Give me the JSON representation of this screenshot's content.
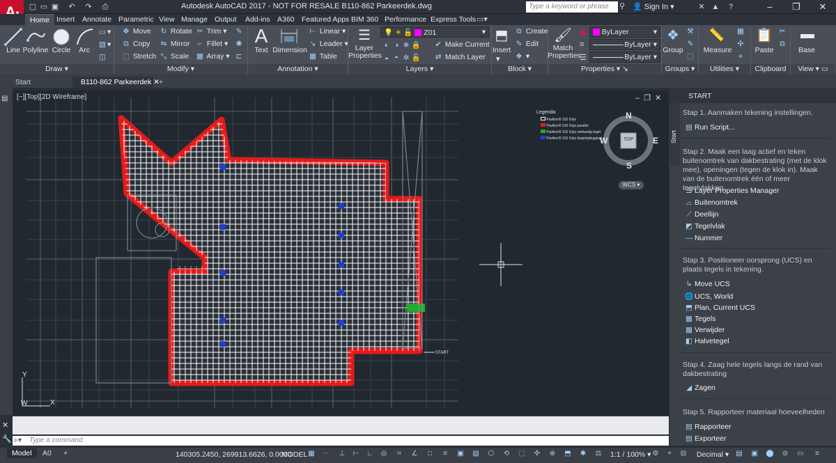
{
  "window": {
    "title": "Autodesk AutoCAD 2017 - NOT FOR RESALE    B110-862 Parkeerdek.dwg",
    "search_placeholder": "Type a keyword or phrase",
    "sign_in": "Sign In"
  },
  "ribbon_tabs": [
    "Home",
    "Insert",
    "Annotate",
    "Parametric",
    "View",
    "Manage",
    "Output",
    "Add-ins",
    "A360",
    "Featured Apps",
    "BIM 360",
    "Performance",
    "Express Tools"
  ],
  "draw": {
    "line": "Line",
    "polyline": "Polyline",
    "circle": "Circle",
    "arc": "Arc",
    "title": "Draw"
  },
  "modify": {
    "move": "Move",
    "rotate": "Rotate",
    "trim": "Trim",
    "copy": "Copy",
    "mirror": "Mirror",
    "fillet": "Fillet",
    "stretch": "Stretch",
    "scale": "Scale",
    "array": "Array",
    "title": "Modify"
  },
  "annotation": {
    "text": "Text",
    "dimension": "Dimension",
    "linear": "Linear",
    "leader": "Leader",
    "table": "Table",
    "title": "Annotation"
  },
  "layers": {
    "layer_properties": "Layer\nProperties",
    "current_layer": "Z01",
    "make_current": "Make Current",
    "match_layer": "Match Layer",
    "title": "Layers"
  },
  "block": {
    "insert": "Insert",
    "create": "Create",
    "edit": "Edit",
    "title": "Block"
  },
  "properties": {
    "match_properties": "Match\nProperties",
    "color": "ByLayer",
    "linetype": "ByLayer",
    "lineweight": "ByLayer",
    "title": "Properties"
  },
  "groups": {
    "group": "Group",
    "title": "Groups"
  },
  "utilities": {
    "measure": "Measure",
    "title": "Utilities"
  },
  "clipboard": {
    "paste": "Paste",
    "title": "Clipboard"
  },
  "view_panel": {
    "base": "Base",
    "title": "View"
  },
  "doc_tabs": [
    "Start",
    "B110-862 Parkeerdek"
  ],
  "viewport": {
    "label": "[−][Top][2D Wireframe]",
    "viewcube": {
      "top": "TOP",
      "n": "N",
      "s": "S",
      "e": "E",
      "w": "W",
      "wcs": "WCS"
    },
    "legend": {
      "title": "Legenda",
      "items": [
        {
          "text": "Pavilion® 310 Grijs",
          "color": "#ffffff"
        },
        {
          "text": "Pavilion® 310 Grijs parallel",
          "color": "#e21b1b"
        },
        {
          "text": "Pavilion® 310 Grijs vierkantig tegel",
          "color": "#1fae2b"
        },
        {
          "text": "Pavilion® 310 Grijs (tegeloplegging)",
          "color": "#1e3fd6"
        }
      ]
    },
    "start_marker": "START",
    "ucs": {
      "x": "X",
      "y": "Y",
      "w": "W"
    }
  },
  "palette": {
    "title": "START",
    "side_tab": "Start",
    "step1": "Stap 1. Aanmaken tekening instellingen.",
    "run_script": "Run Script...",
    "step2": "Stap 2. Maak een laag actief en teken buitenomtrek van dakbestrating (met de klok mee), openingen (tegen de klok in). Maak van de buitenomtrek één of meer tegelvlakken.",
    "layer_manager": "Layer Properties Manager",
    "buitenomtrek": "Buitenomtrek",
    "deellijn": "Deellijn",
    "tegelvlak": "Tegelvlak",
    "nummer": "Nummer",
    "step3": "Stap 3. Positioneer oorsprong (UCS) en plaats tegels in tekening.",
    "move_ucs": "Move UCS",
    "ucs_world": "UCS, World",
    "plan_current": "Plan, Current UCS",
    "tegels": "Tegels",
    "verwijder": "Verwijder",
    "halvetegel": "Halvetegel",
    "step4": "Stap 4. Zaag hele tegels langs de rand van dakbestrating",
    "zagen": "Zagen",
    "step5": "Stap 5. Rapporteer materiaal hoeveelheden",
    "rapporteer": "Rapporteer",
    "exporteer": "Exporteer"
  },
  "command": {
    "placeholder": "Type a command"
  },
  "status": {
    "tabs": [
      "Model",
      "A0"
    ],
    "coords": "140305.2450, 269913.6626, 0.0000",
    "model": "MODEL",
    "scale": "1:1 / 100%",
    "units": "Decimal"
  },
  "colors": {
    "accent": "#c8102e",
    "tile_border": "#e21b1b",
    "tile_fill": "#ffffff",
    "marker": "#1e3fd6",
    "green": "#1fae2b",
    "bg": "#212830"
  }
}
